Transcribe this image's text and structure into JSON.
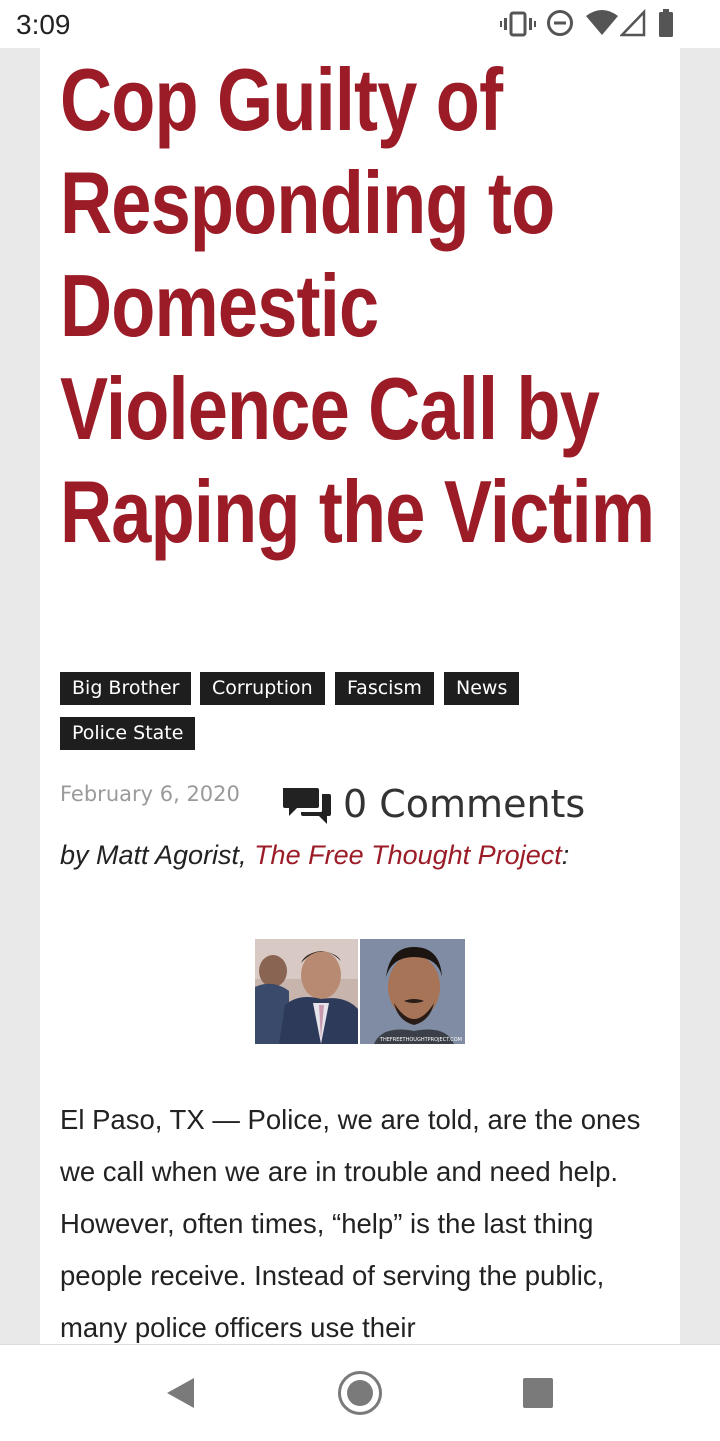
{
  "status_bar": {
    "time": "3:09",
    "icons": [
      "vibrate-icon",
      "do-not-disturb-icon",
      "wifi-icon",
      "signal-icon",
      "battery-icon"
    ]
  },
  "article": {
    "title": "Cop Guilty of Responding to Domestic Violence Call by Raping the Victim",
    "tags": [
      "Big Brother",
      "Corruption",
      "Fascism",
      "News",
      "Police State"
    ],
    "date": "February 6, 2020",
    "comments_label": "0 Comments",
    "byline": {
      "prefix": "by Matt Agorist, ",
      "source": "The Free Thought Project",
      "suffix": ":"
    },
    "image_watermark": "THEFREETHOUGHTPROJECT.COM",
    "body": "El Paso, TX — Police, we are told, are the ones we call when we are in trouble and need help. However, often times, “help” is the last thing people receive. Instead of serving the public, many police officers use their"
  },
  "colors": {
    "title": "#9b1c27",
    "tag_bg": "#1e1e1e",
    "link": "#9b1c27"
  },
  "nav_bar": {
    "buttons": [
      "back-icon",
      "home-icon",
      "recents-icon"
    ]
  }
}
